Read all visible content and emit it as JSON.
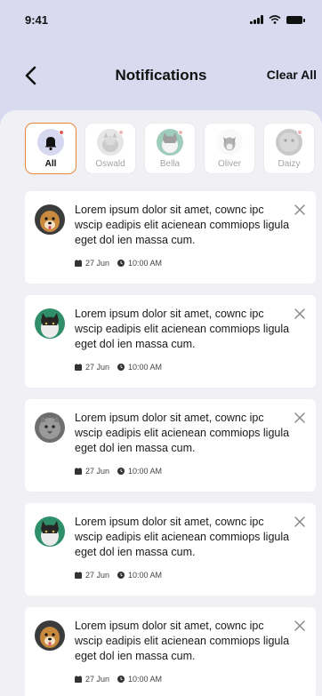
{
  "status_bar": {
    "time": "9:41",
    "icons": [
      "signal-icon",
      "wifi-icon",
      "battery-icon"
    ]
  },
  "header": {
    "title": "Notifications",
    "back_icon": "chevron-left-icon",
    "clear_label": "Clear All"
  },
  "filters": [
    {
      "label": "All",
      "icon": "bell-icon",
      "active": true,
      "has_dot": true
    },
    {
      "label": "Oswald",
      "icon": "pet-avatar",
      "active": false,
      "has_dot": true
    },
    {
      "label": "Bella",
      "icon": "pet-avatar",
      "active": false,
      "has_dot": true
    },
    {
      "label": "Oliver",
      "icon": "pet-avatar",
      "active": false,
      "has_dot": false
    },
    {
      "label": "Daizy",
      "icon": "pet-avatar",
      "active": false,
      "has_dot": true
    }
  ],
  "notifications": [
    {
      "avatar": "dog-avatar",
      "text": "Lorem ipsum dolor sit amet, cownc ipc wscip eadipis elit acienean commiops ligula eget dol ien massa cum.",
      "date": "27 Jun",
      "time": "10:00 AM"
    },
    {
      "avatar": "cat-avatar",
      "text": "Lorem ipsum dolor sit amet, cownc ipc wscip eadipis elit acienean commiops ligula eget dol ien massa cum.",
      "date": "27 Jun",
      "time": "10:00 AM"
    },
    {
      "avatar": "cat-avatar-grey",
      "text": "Lorem ipsum dolor sit amet, cownc ipc wscip eadipis elit acienean commiops ligula eget dol ien massa cum.",
      "date": "27 Jun",
      "time": "10:00 AM"
    },
    {
      "avatar": "cat-avatar",
      "text": "Lorem ipsum dolor sit amet, cownc ipc wscip eadipis elit acienean commiops ligula eget dol ien massa cum.",
      "date": "27 Jun",
      "time": "10:00 AM"
    },
    {
      "avatar": "dog-avatar",
      "text": "Lorem ipsum dolor sit amet, cownc ipc wscip eadipis elit acienean commiops ligula eget dol ien massa cum.",
      "date": "27 Jun",
      "time": "10:00 AM"
    }
  ],
  "colors": {
    "header_bg": "#d9d9f0",
    "sheet_bg": "#f1f1f5",
    "active_border": "#e5843a",
    "dot": "#e05a5a"
  }
}
